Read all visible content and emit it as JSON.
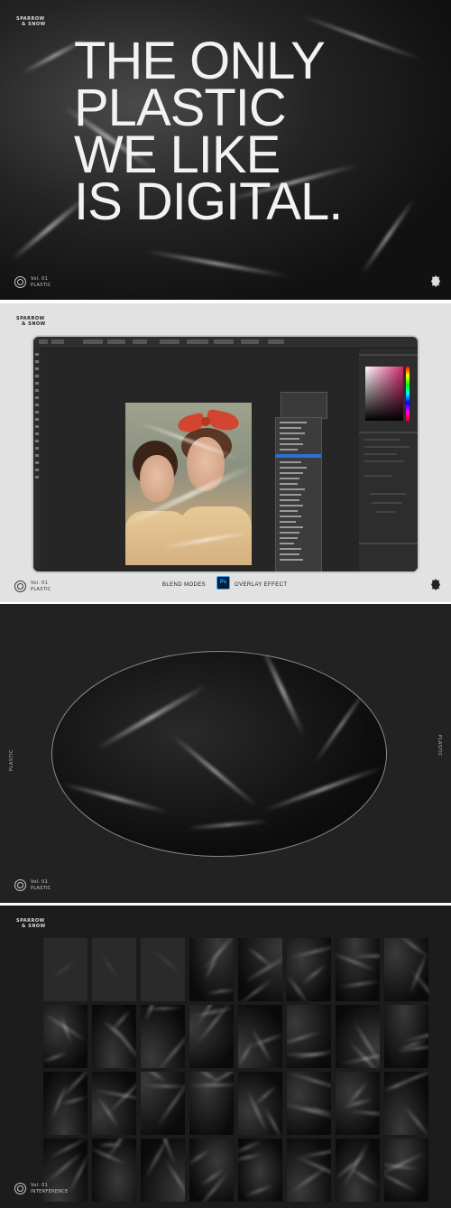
{
  "panel1": {
    "brand_line1": "SPARROW",
    "brand_line2": "& SNOW",
    "headline": [
      "THE ONLY",
      "PLASTIC",
      "WE LIKE",
      "IS DIGITAL."
    ],
    "vol": "Vol. 01",
    "sub": "PLASTIC"
  },
  "panel2": {
    "brand_line1": "SPARROW",
    "brand_line2": "& SNOW",
    "vol": "Vol. 01",
    "sub": "PLASTIC",
    "caption_left": "BLEND MODES",
    "ps_badge": "Ps",
    "caption_right": "OVERLAY EFFECT"
  },
  "panel3": {
    "side_left": "PLASTIC",
    "side_right": "PLASTIC",
    "vol": "Vol. 01",
    "sub": "PLASTIC"
  },
  "panel4": {
    "brand_line1": "SPARROW",
    "brand_line2": "& SNOW",
    "vol": "Vol. 01",
    "sub": "INTERFERENCE"
  },
  "colors": {
    "dark_bg": "#222222",
    "light_bg": "#e2e2e2",
    "ps_blue": "#31a8ff",
    "bow_red": "#d2452f"
  }
}
